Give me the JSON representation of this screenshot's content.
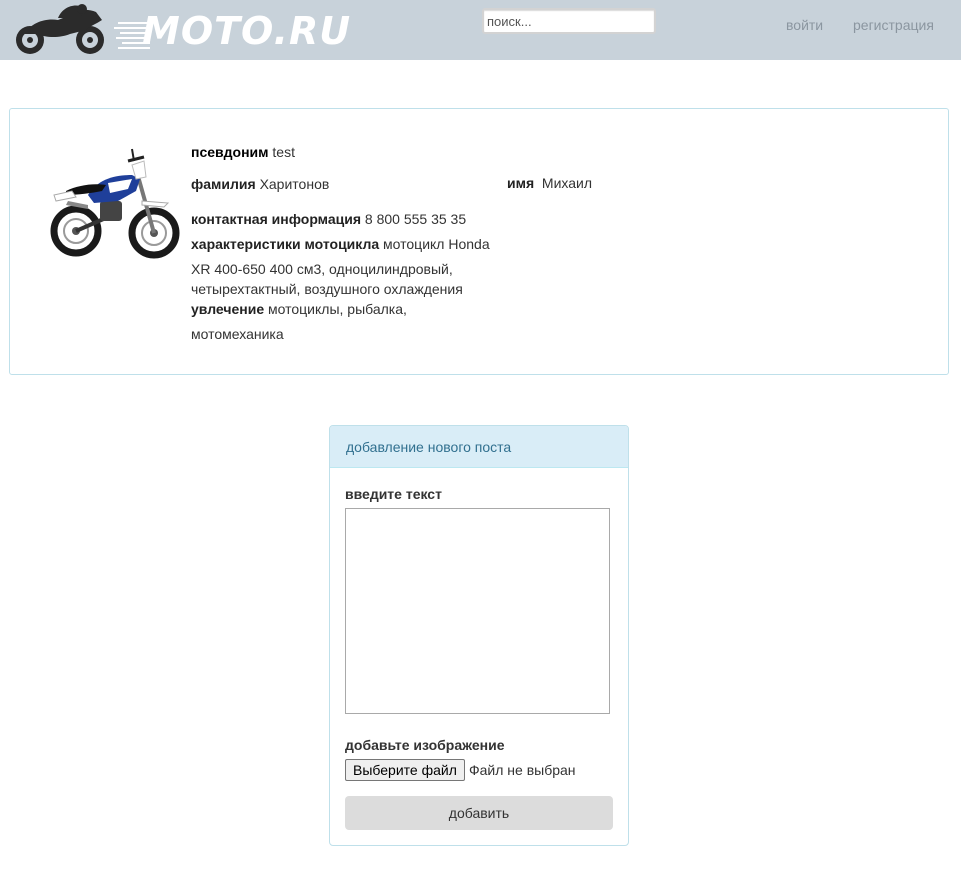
{
  "header": {
    "logo_text": "MOTO.RU",
    "search": {
      "placeholder": "поиск...",
      "value": ""
    },
    "login_label": "войти",
    "register_label": "регистрация"
  },
  "profile": {
    "nickname_label": "псевдоним",
    "nickname_value": "test",
    "surname_label": "фамилия",
    "surname_value": "Харитонов",
    "name_label": "имя",
    "name_value": "Михаил",
    "contact_label": "контактная информация",
    "contact_value": "8 800 555 35 35",
    "moto_label": "характеристики мотоцикла",
    "moto_value_line1": "мотоцикл Honda",
    "moto_value_line2": "XR 400-650 400 см3, одноцилиндровый, четырехтактный, воздушного охлаждения",
    "hobby_label": "увлечение",
    "hobby_value_line1": "мотоциклы, рыбалка,",
    "hobby_value_line2": "мотомеханика"
  },
  "new_post": {
    "heading": "добавление нового поста",
    "text_label": "введите текст",
    "text_value": "",
    "image_label": "добавьте изображение",
    "file_button_label": "Выберите файл",
    "file_status": "Файл не выбран",
    "submit_label": "добавить"
  },
  "colors": {
    "header_bg": "#c8d2da",
    "panel_border": "#bfe0ea",
    "heading_bg": "#d9edf7",
    "heading_text": "#31708f",
    "nav_link": "#8b96a0"
  },
  "icons": {
    "logo_icon": "motorcycle-rider-silhouette",
    "profile_photo": "dirt-bike-photo"
  }
}
